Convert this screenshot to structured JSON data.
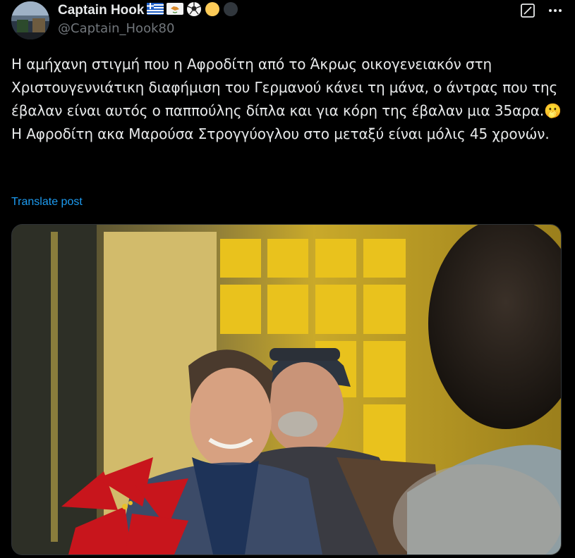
{
  "author": {
    "display_name": "Captain Hook",
    "handle": "@Captain_Hook80",
    "badges": [
      "flag-greece-icon",
      "flag-cyprus-icon",
      "soccer-ball-icon",
      "yellow-circle-icon",
      "dark-circle-icon"
    ]
  },
  "actions": {
    "grok_icon": "grok-icon",
    "more_icon": "more-icon"
  },
  "post": {
    "text": "Η αμήχανη στιγμή που η Αφροδίτη από το Άκρως οικογενειακόν στη Χριστουγεννιάτικη διαφήμιση του Γερμανού κάνει τη μάνα, ο άντρας που της έβαλαν είναι αυτός ο παππούλης δίπλα και για κόρη της έβαλαν μια 35αρα.",
    "emoji": "🫢",
    "text2": "Η Αφροδίτη ακα Μαρούσα Στρογγύογλου στο μεταξύ είναι μόλις 45 χρονών.",
    "translate_label": "Translate post"
  },
  "colors": {
    "background": "#000000",
    "text": "#e7e9ea",
    "secondary": "#71767b",
    "link": "#1d9bf0"
  }
}
